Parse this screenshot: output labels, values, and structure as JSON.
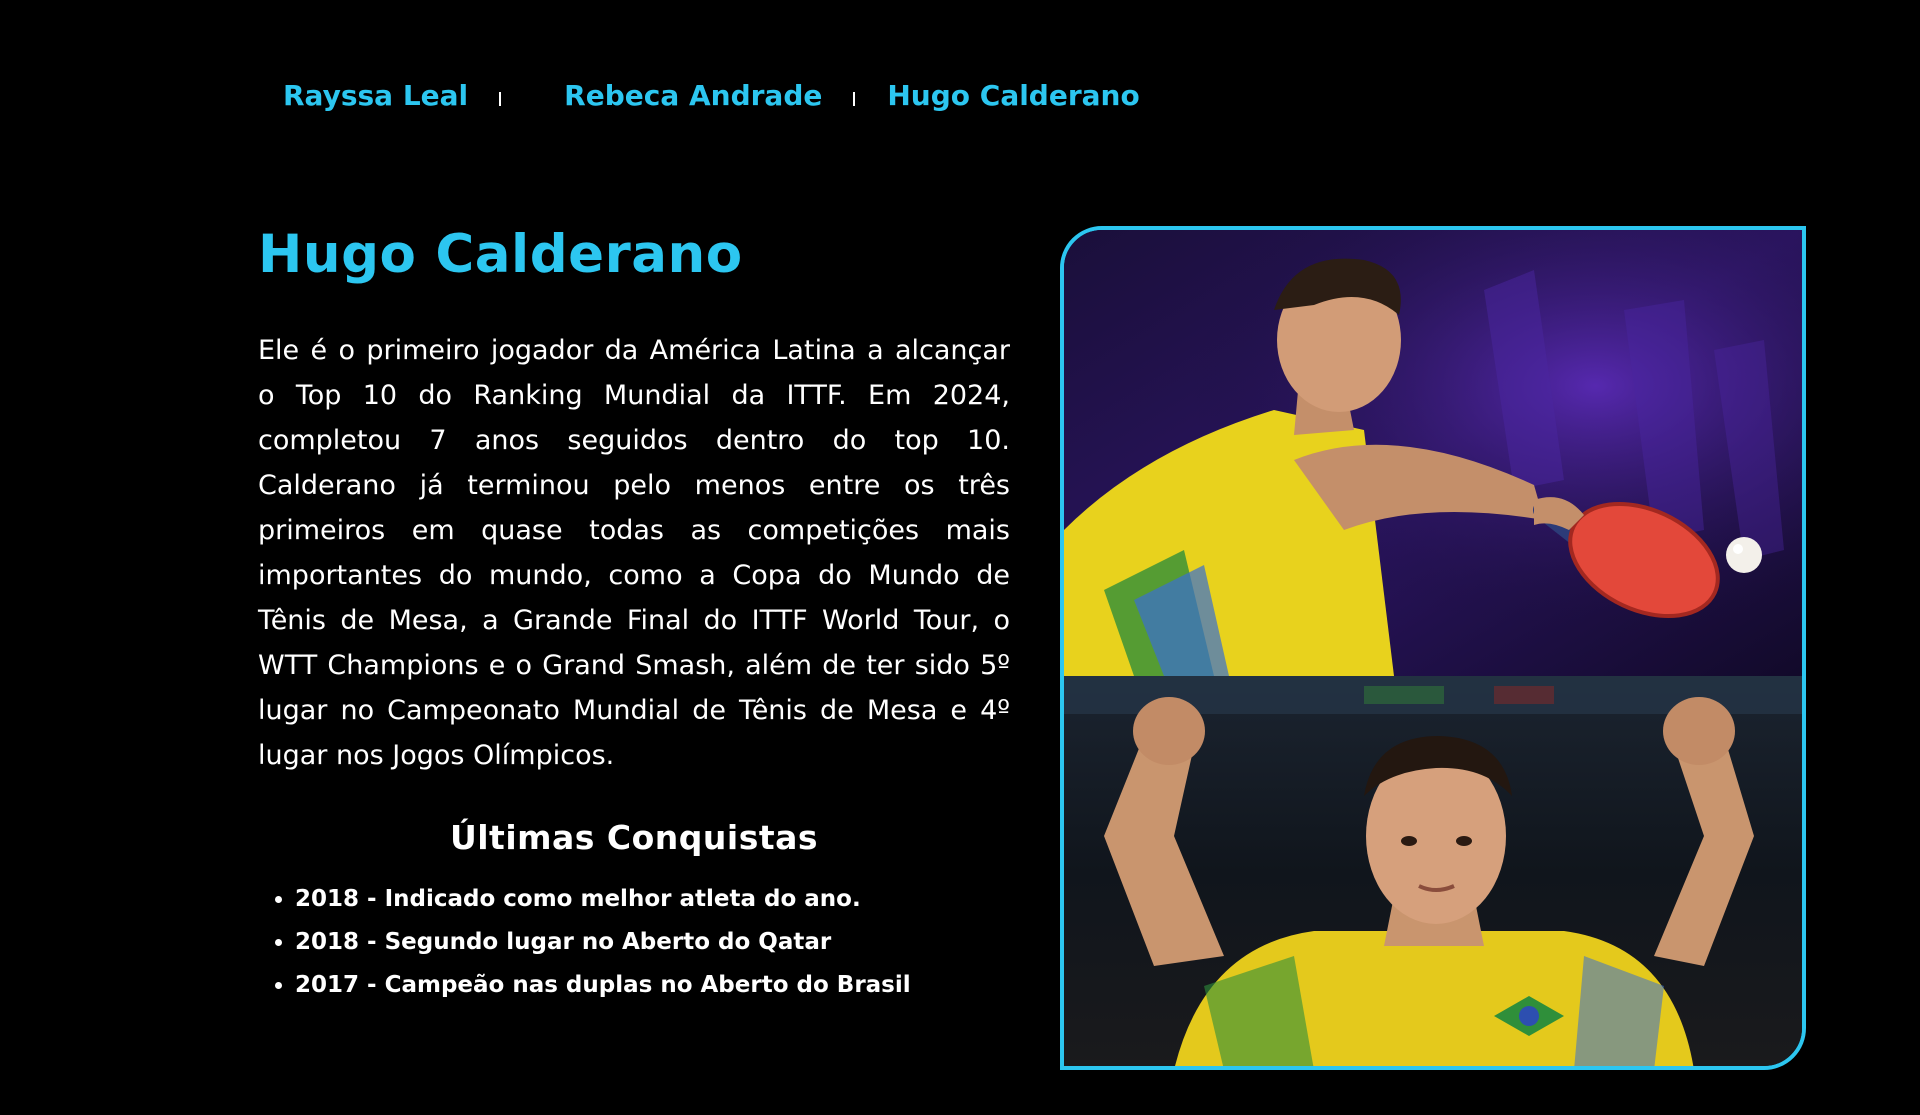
{
  "nav": {
    "links": [
      "Rayssa Leal",
      "Rebeca Andrade",
      "Hugo Calderano"
    ],
    "separator": "|"
  },
  "athlete": {
    "name": "Hugo Calderano",
    "bio": "Ele é o primeiro jogador da América Latina a alcançar o Top 10 do Ranking Mundial da ITTF. Em 2024, completou 7 anos seguidos dentro do top 10. Calderano já terminou pelo menos entre os três primeiros em quase todas as competições mais importantes do mundo, como a Copa do Mundo de Tênis de Mesa, a Grande Final do ITTF World Tour, o WTT Champions e o Grand Smash, além de ter sido 5º lugar no Campeonato Mundial de Tênis de Mesa e 4º lugar nos Jogos Olímpicos."
  },
  "achievements": {
    "title": "Últimas Conquistas",
    "items": [
      "2018 - Indicado como melhor atleta do ano.",
      "2018 - Segundo lugar no Aberto do Qatar",
      "2017 - Campeão nas duplas no Aberto do Brasil"
    ]
  },
  "colors": {
    "background": "#000000",
    "accent": "#2cc6f0",
    "text": "#ffffff"
  }
}
